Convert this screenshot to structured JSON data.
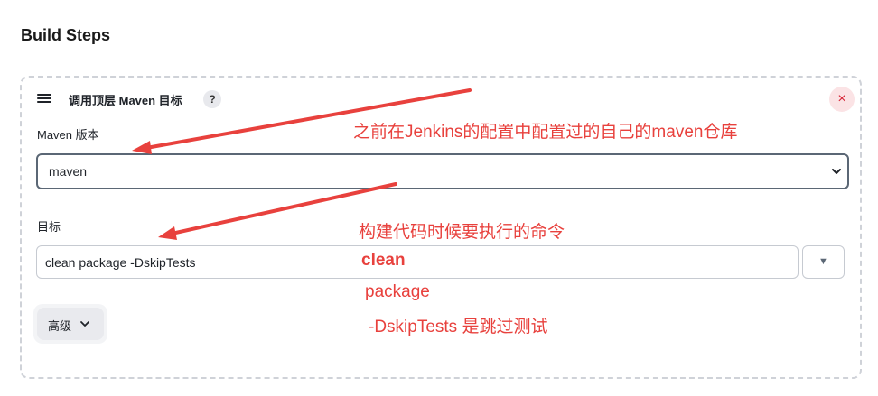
{
  "section": {
    "title": "Build Steps"
  },
  "step": {
    "title": "调用顶层 Maven 目标",
    "help_glyph": "?",
    "close_glyph": "×"
  },
  "fields": {
    "maven_version": {
      "label": "Maven 版本",
      "value": "maven"
    },
    "goals": {
      "label": "目标",
      "value": "clean package -DskipTests",
      "expand_glyph": "▼"
    }
  },
  "advanced": {
    "label": "高级"
  },
  "annotations": {
    "maven_note": "之前在Jenkins的配置中配置过的自己的maven仓库",
    "goals_note": "构建代码时候要执行的命令",
    "clean": "clean",
    "package": "package",
    "skip_tests": "-DskipTests 是跳过测试"
  },
  "colors": {
    "annotation": "#e8413d",
    "close_bg": "#fbe3e5",
    "close_fg": "#d72638"
  }
}
